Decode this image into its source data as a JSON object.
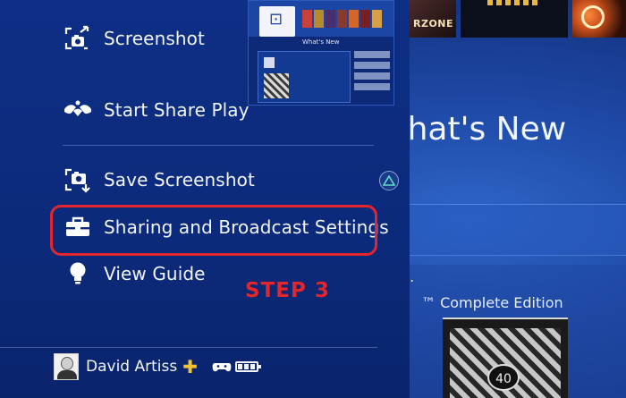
{
  "background": {
    "heading": "What's New",
    "text_line_1": "es.",
    "text_line_2": "™ Complete Edition",
    "tiles": [
      {
        "label": "RZONE"
      },
      {
        "label": ""
      },
      {
        "label": ""
      }
    ],
    "game_art_number": "40"
  },
  "thumbnail": {
    "caption": "What's New"
  },
  "quick_menu": {
    "items": [
      {
        "label": "Screenshot",
        "icon": "screenshot-share-icon"
      },
      {
        "label": "Start Share Play",
        "icon": "share-play-icon"
      },
      {
        "label": "Save Screenshot",
        "icon": "save-screenshot-icon",
        "shortcut": "triangle"
      },
      {
        "label": "Sharing and Broadcast Settings",
        "icon": "toolbox-icon"
      },
      {
        "label": "View Guide",
        "icon": "lightbulb-icon"
      }
    ]
  },
  "annotation": {
    "step_label": "STEP 3",
    "highlight_color": "#e3262b"
  },
  "user": {
    "name": "David Artiss",
    "plus_symbol": "✚",
    "battery_cells": 3
  },
  "colors": {
    "panel": "#0c2a7b",
    "accent_plus": "#f2c230",
    "highlight": "#e3262b"
  }
}
